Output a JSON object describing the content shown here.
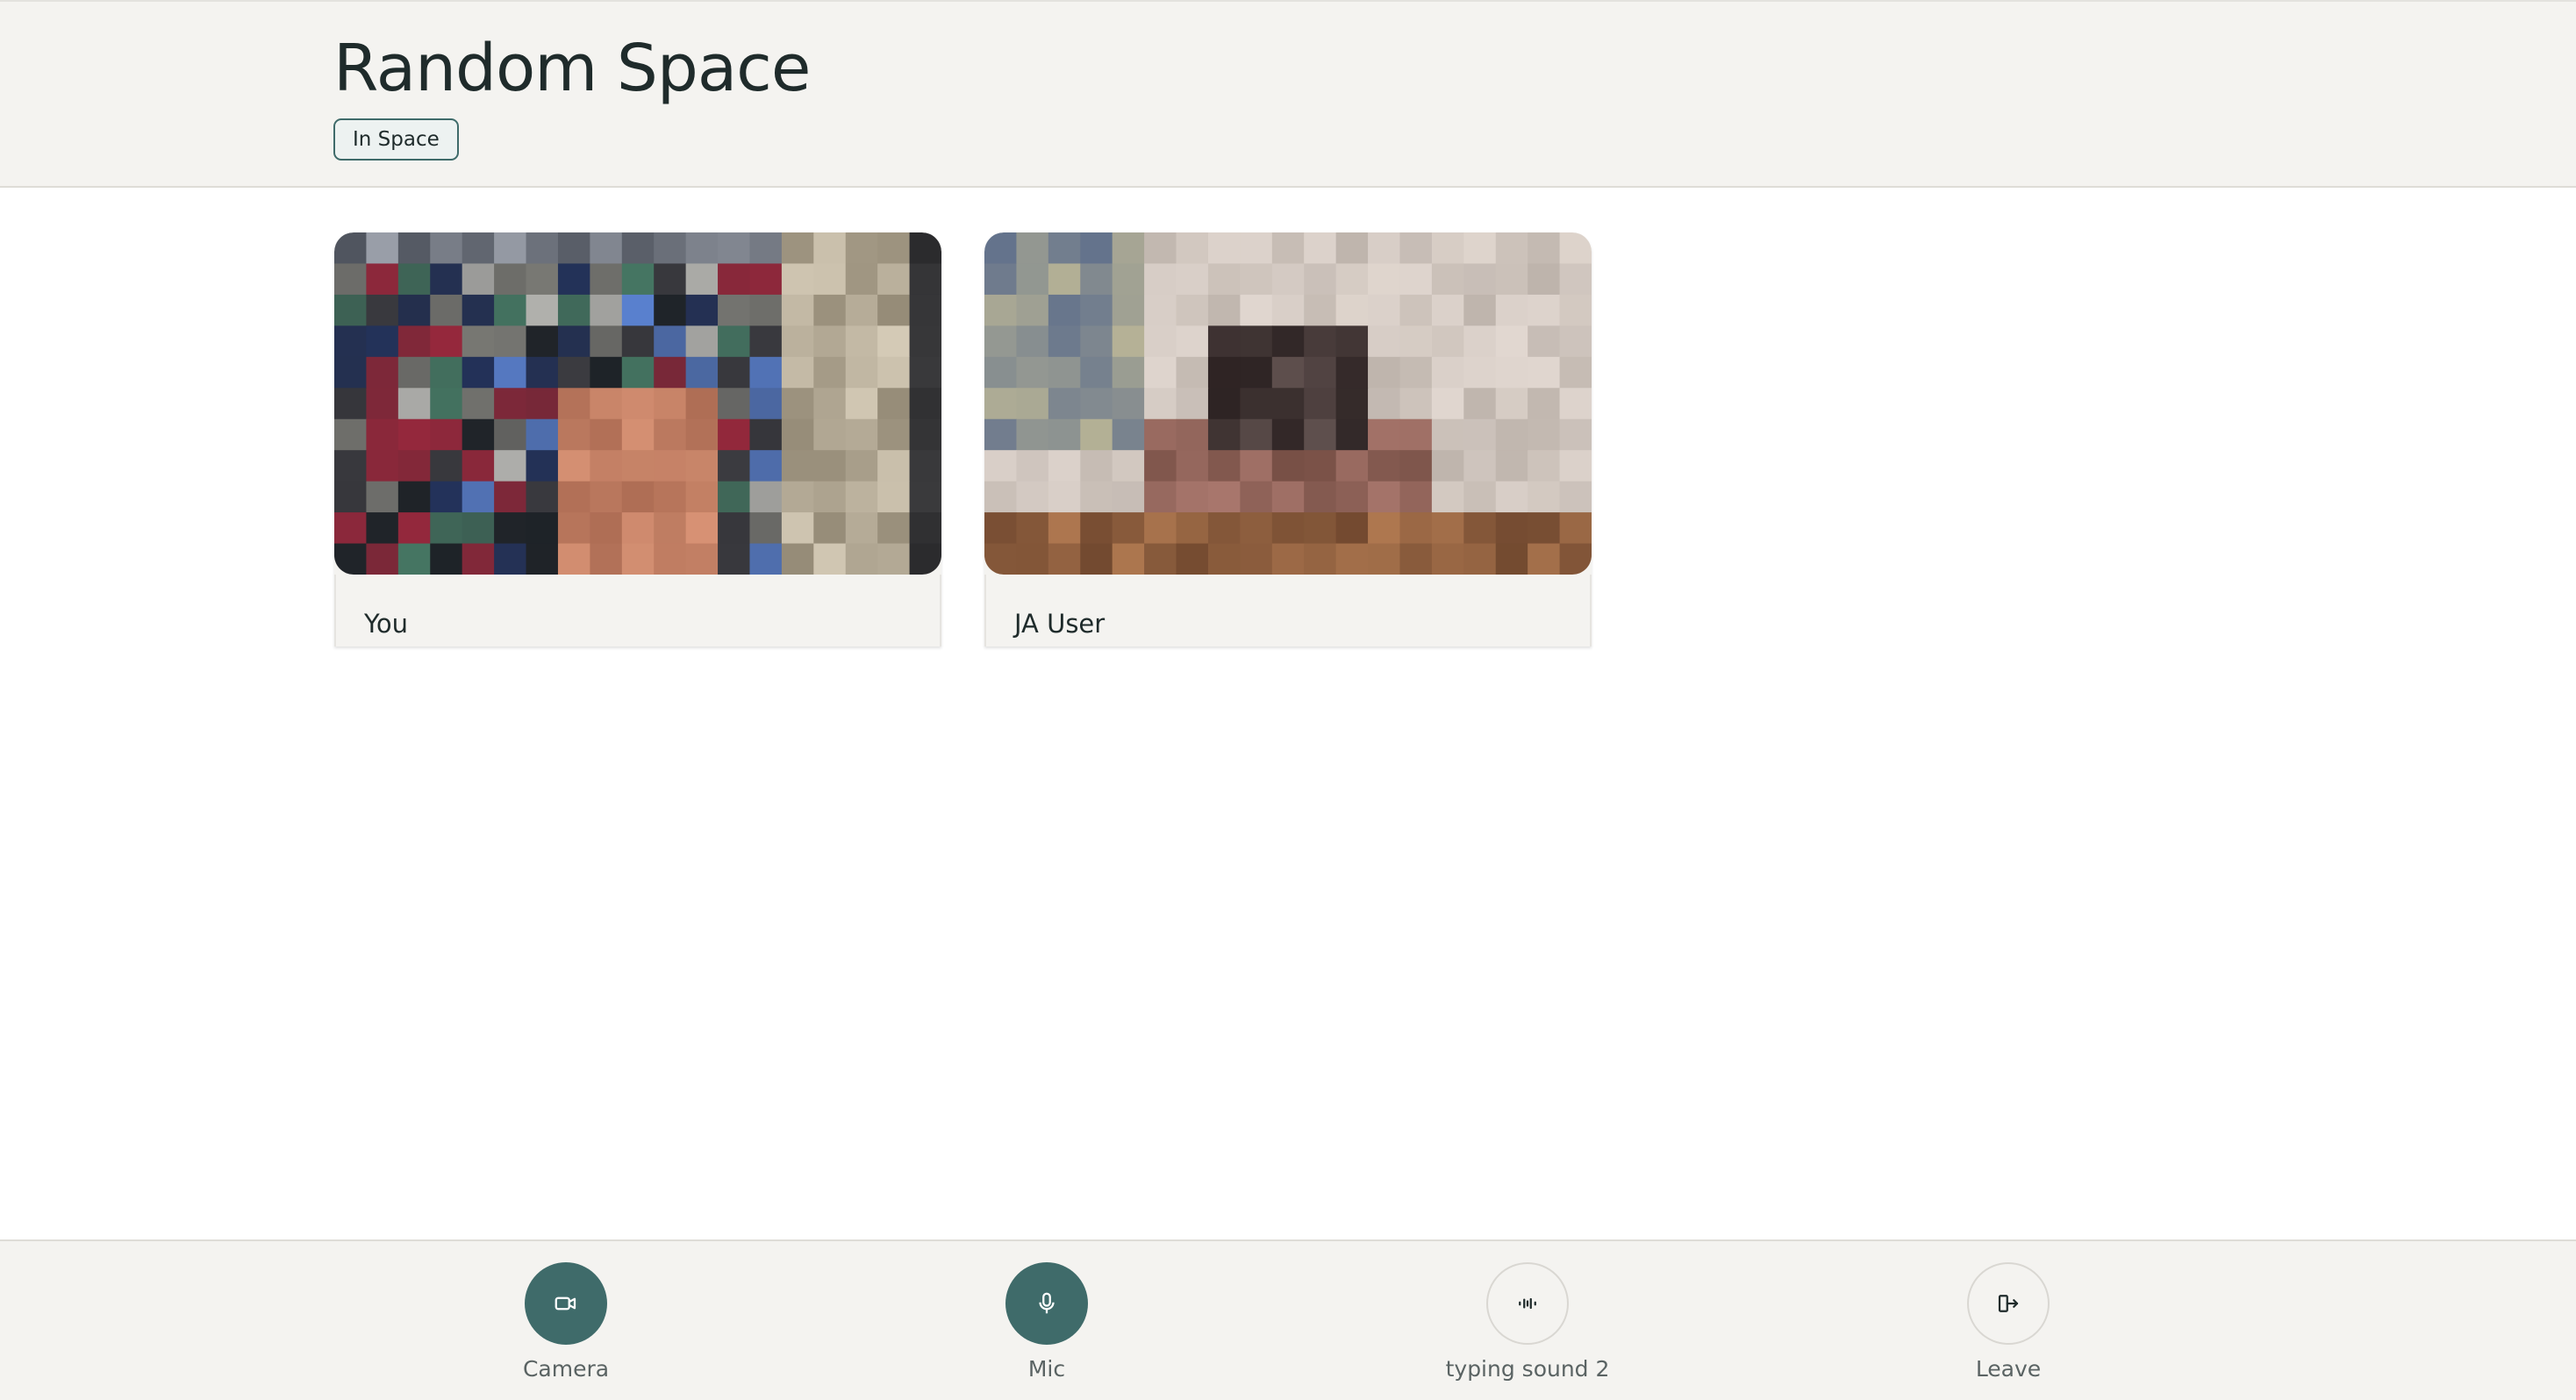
{
  "header": {
    "title": "Random Space",
    "status_badge": "In Space"
  },
  "participants": [
    {
      "name": "You"
    },
    {
      "name": "JA User"
    }
  ],
  "toolbar": {
    "camera_label": "Camera",
    "mic_label": "Mic",
    "sound_label": "typing sound 2",
    "leave_label": "Leave"
  },
  "colors": {
    "accent": "#3f6b6a",
    "background": "#f4f3f0",
    "text": "#1f2b2b"
  },
  "icons": {
    "camera": "video-camera-icon",
    "mic": "microphone-icon",
    "sound": "audio-waveform-icon",
    "leave": "leave-door-icon"
  }
}
